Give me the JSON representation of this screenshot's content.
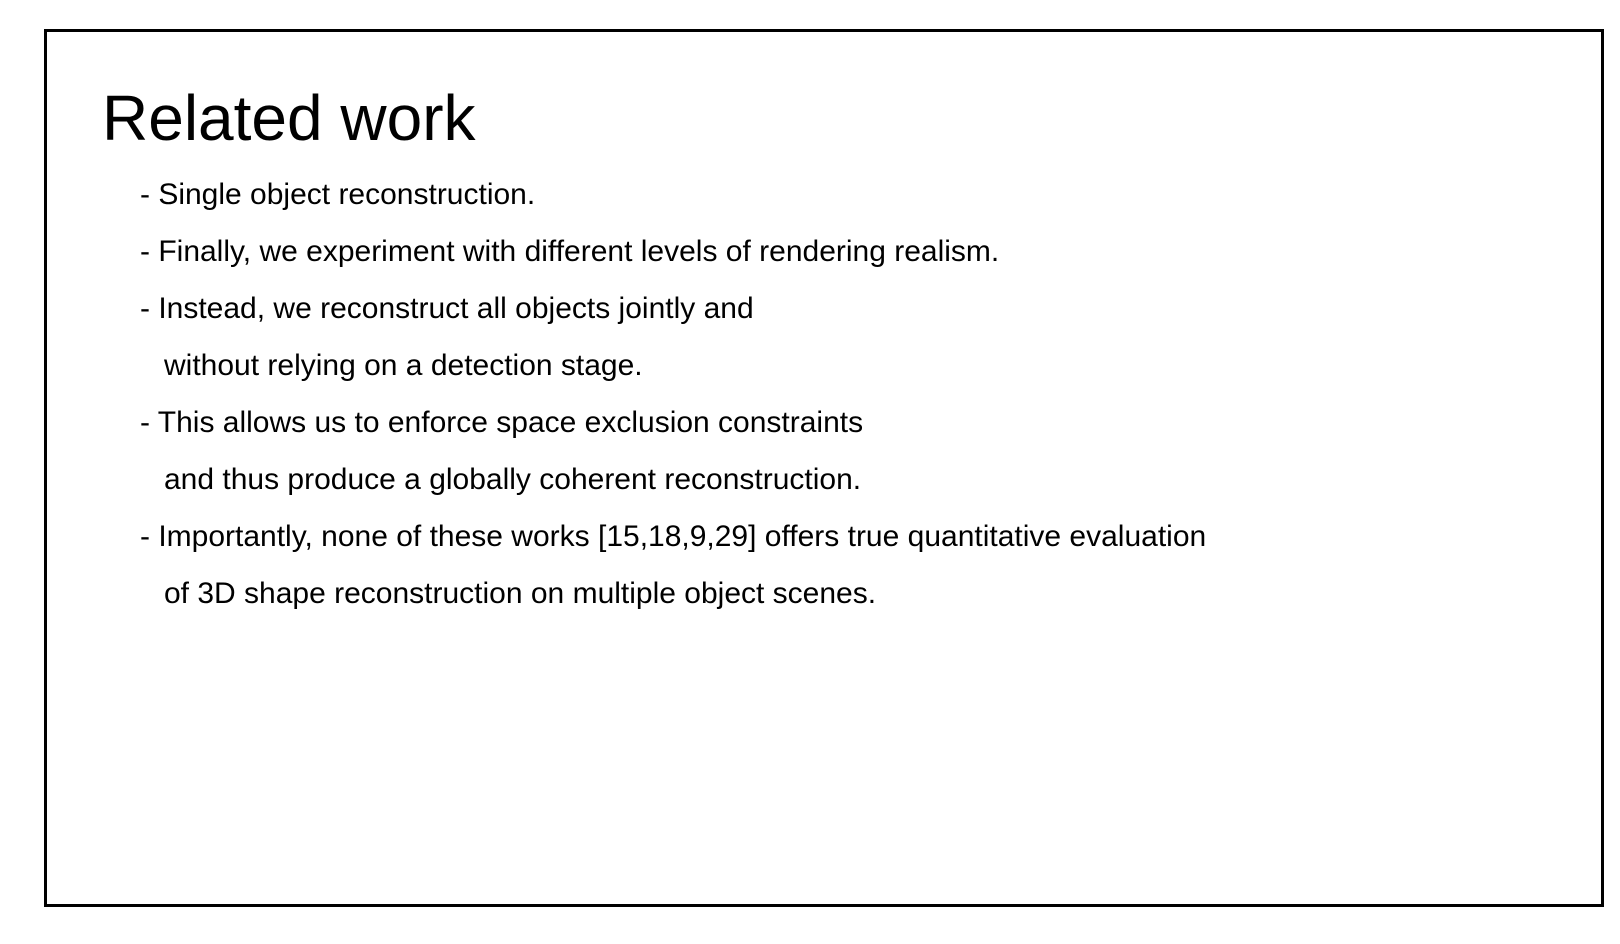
{
  "slide": {
    "title": "Related work",
    "lines": [
      {
        "text": "- Single object reconstruction."
      },
      {
        "text": "- Finally, we experiment with different levels of rendering realism."
      },
      {
        "text": "- Instead, we reconstruct all objects jointly and"
      },
      {
        "text": "without relying on a detection stage."
      },
      {
        "text": "- This allows us to enforce space exclusion constraints"
      },
      {
        "text": "and thus produce a globally coherent reconstruction."
      },
      {
        "text": "- Importantly, none of these works [15,18,9,29] offers true quantitative evaluation"
      },
      {
        "text": "of 3D shape reconstruction on multiple object scenes."
      }
    ]
  }
}
